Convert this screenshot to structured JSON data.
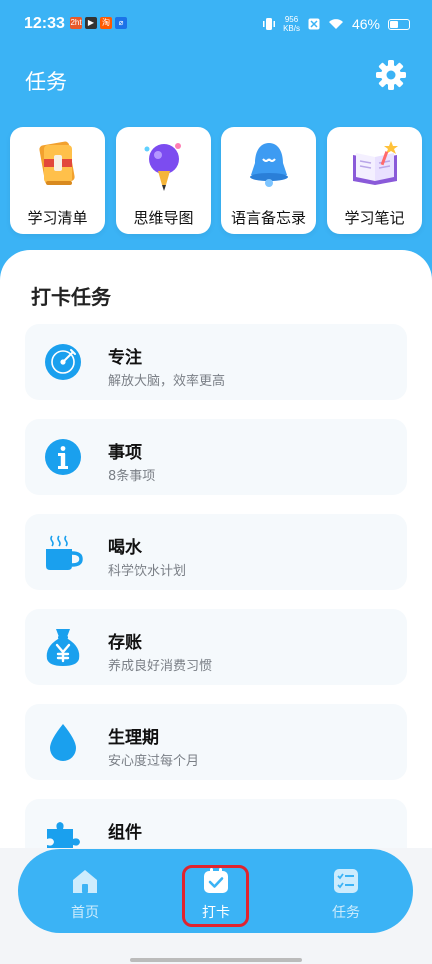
{
  "status_bar": {
    "time": "12:33",
    "apps": [
      "2ht",
      "▶",
      "淘",
      "⌀"
    ],
    "net_speed_value": "956",
    "net_speed_unit": "KB/s",
    "battery_text": "46%",
    "battery_level": 0.46
  },
  "header": {
    "title": "任务"
  },
  "quick_cards": [
    {
      "label": "学习清单",
      "icon": "book-icon"
    },
    {
      "label": "思维导图",
      "icon": "idea-pen-icon"
    },
    {
      "label": "语言备忘录",
      "icon": "bell-icon"
    },
    {
      "label": "学习笔记",
      "icon": "open-notebook-icon"
    }
  ],
  "section_title": "打卡任务",
  "tasks": [
    {
      "name": "专注",
      "desc": "解放大脑，效率更高",
      "icon": "focus-icon"
    },
    {
      "name": "事项",
      "desc": "8条事项",
      "icon": "info-icon"
    },
    {
      "name": "喝水",
      "desc": "科学饮水计划",
      "icon": "cup-icon"
    },
    {
      "name": "存账",
      "desc": "养成良好消费习惯",
      "icon": "money-bag-icon"
    },
    {
      "name": "生理期",
      "desc": "安心度过每个月",
      "icon": "drop-icon"
    },
    {
      "name": "组件",
      "desc": "",
      "icon": "puzzle-icon"
    }
  ],
  "bottom_nav": [
    {
      "label": "首页",
      "icon": "home-icon",
      "active": false
    },
    {
      "label": "打卡",
      "icon": "checkin-icon",
      "active": true
    },
    {
      "label": "任务",
      "icon": "task-list-icon",
      "active": false
    }
  ],
  "colors": {
    "primary": "#3bb3f5",
    "accent_icon": "#1aa0ee",
    "highlight": "#e0232f"
  }
}
